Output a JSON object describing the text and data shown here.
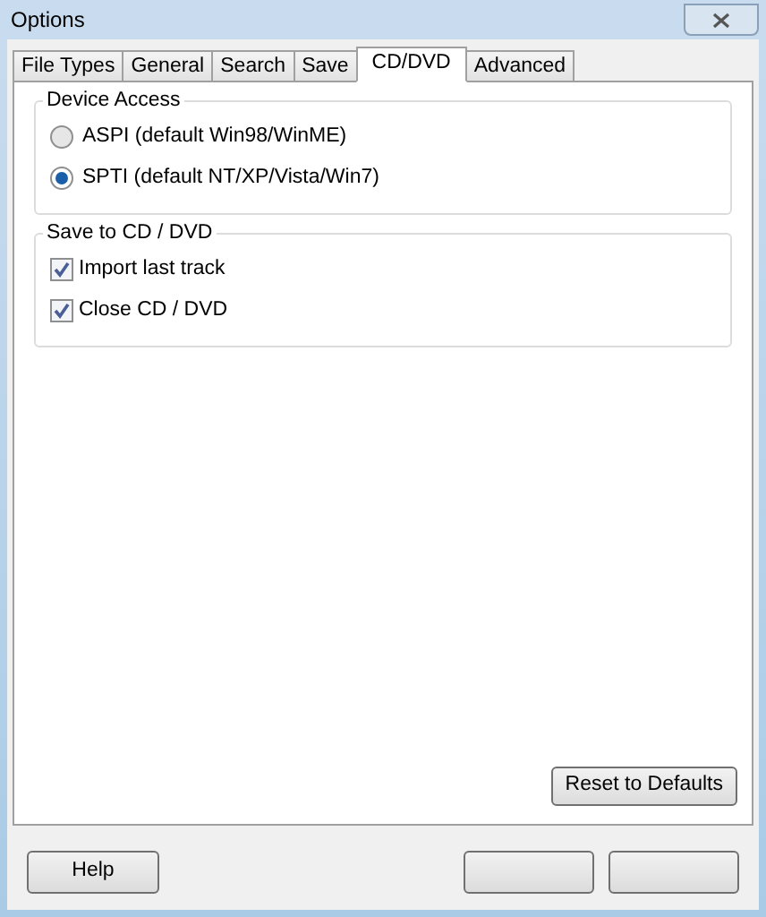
{
  "window": {
    "title": "Options"
  },
  "tabs": [
    {
      "label": "File Types",
      "selected": false
    },
    {
      "label": "General",
      "selected": false
    },
    {
      "label": "Search",
      "selected": false
    },
    {
      "label": "Save",
      "selected": false
    },
    {
      "label": "CD/DVD",
      "selected": true
    },
    {
      "label": "Advanced",
      "selected": false
    }
  ],
  "groups": [
    {
      "title": "Device Access",
      "items": [
        {
          "kind": "radio",
          "label": "ASPI (default Win98/WinME)",
          "selected": false
        },
        {
          "kind": "radio",
          "label": "SPTI (default NT/XP/Vista/Win7)",
          "selected": true
        }
      ]
    },
    {
      "title": "Save to CD / DVD",
      "items": [
        {
          "kind": "checkbox",
          "label": "Import last track",
          "checked": true
        },
        {
          "kind": "checkbox",
          "label": "Close CD / DVD",
          "checked": true
        }
      ]
    }
  ],
  "reset_button": "Reset to Defaults",
  "footer": {
    "help_button": "Help"
  }
}
